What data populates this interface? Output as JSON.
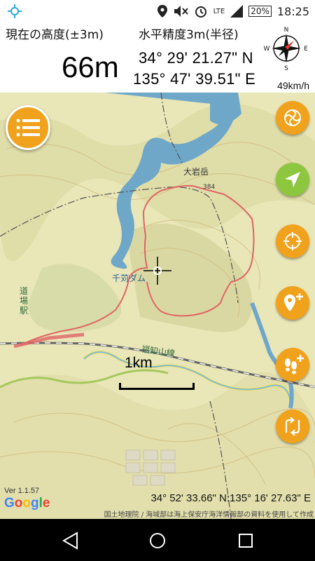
{
  "status_bar": {
    "network": "LTE",
    "battery": "20%",
    "time": "18:25"
  },
  "info": {
    "altitude_label": "現在の高度(±3m)",
    "accuracy_label": "水平精度3m(半径)",
    "altitude_value": "66m",
    "latitude": "34° 29' 21.27\" N",
    "longitude": "135° 47' 39.51\" E",
    "compass_letters": [
      "N",
      "E",
      "S",
      "W"
    ],
    "speed": "49km/h"
  },
  "map": {
    "labels": {
      "mountain": "大岩岳",
      "elevation": "384",
      "dam": "千苅ダム",
      "station": "道場駅",
      "railway": "福知山線"
    },
    "scale_label": "1km",
    "version": "Ver 1.1.57",
    "google": [
      "G",
      "o",
      "o",
      "g",
      "l",
      "e"
    ],
    "cursor_coordinate": "34° 52' 33.66\" N:135° 16' 27.63\" E",
    "attribution": "国土地理院 / 海域部は海上保安庁海洋情報部の資料を使用して作成"
  },
  "colors": {
    "accent_orange": "#f0a21c",
    "accent_green": "#8dc63f",
    "track_red": "#e06464"
  },
  "icons": {
    "menu": "menu-icon",
    "layers": "swirl-icon",
    "navigate": "navigation-arrow-icon",
    "target": "crosshair-target-icon",
    "add_location": "add-location-icon",
    "add_footprints": "add-footprints-icon",
    "route": "route-icon"
  }
}
